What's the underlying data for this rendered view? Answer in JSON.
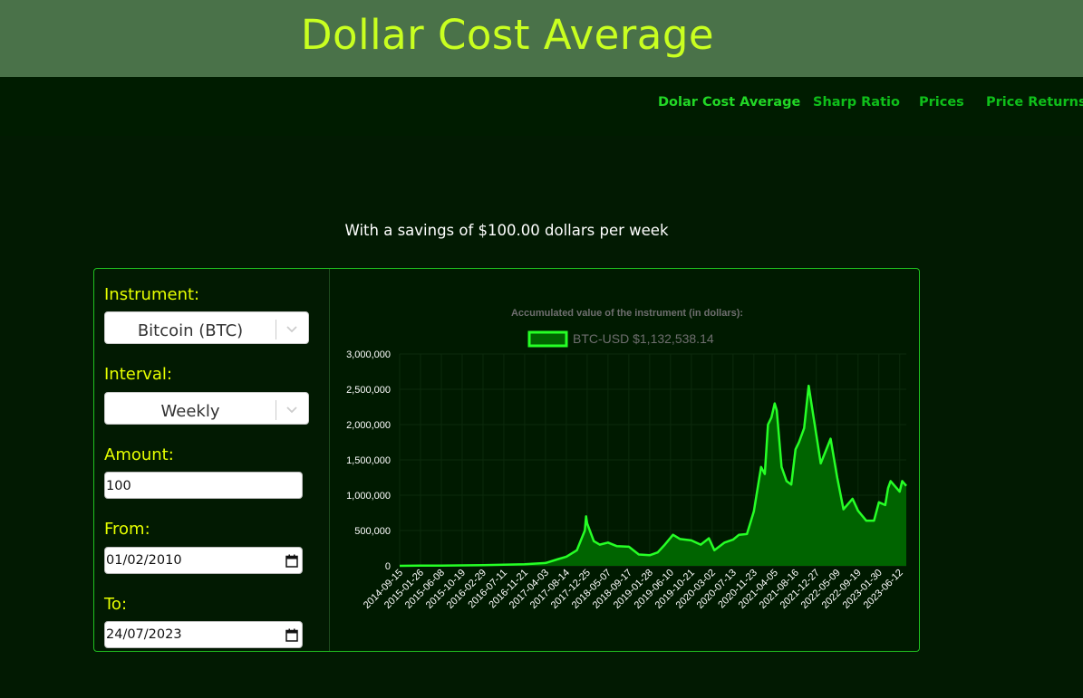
{
  "header": {
    "title": "Dollar Cost Average"
  },
  "nav": {
    "items": [
      {
        "label": "Dolar Cost Average"
      },
      {
        "label": "Sharp Ratio"
      },
      {
        "label": "Prices"
      },
      {
        "label": "Price Returns"
      }
    ]
  },
  "summary": {
    "text": "With a savings of $100.00 dollars per week"
  },
  "form": {
    "instrument_label": "Instrument:",
    "instrument_value": "Bitcoin (BTC)",
    "interval_label": "Interval:",
    "interval_value": "Weekly",
    "amount_label": "Amount:",
    "amount_value": "100",
    "from_label": "From:",
    "from_value": "01/02/2010",
    "to_label": "To:",
    "to_value": "24/07/2023"
  },
  "colors": {
    "banner_bg": "#4a7249",
    "title": "#c9ff20",
    "nav_bg": "#001c00",
    "nav_link": "#0fbf1a",
    "page_bg": "#021a02",
    "label": "#e6ff00",
    "line": "#26ff26",
    "fill": "#006400"
  },
  "icons": {
    "dropdown": "chevron-down-icon",
    "calendar": "calendar-icon"
  },
  "chart_data": {
    "type": "area",
    "title": "Accumulated value of the instrument (in dollars):",
    "legend": {
      "label": "BTC-USD $1,132,538.14",
      "placement": "top-center"
    },
    "y_ticks": [
      "0",
      "500,000",
      "1,000,000",
      "1,500,000",
      "2,000,000",
      "2,500,000",
      "3,000,000"
    ],
    "ylim": [
      0,
      3000000
    ],
    "x_ticks": [
      "2014-09-15",
      "2015-01-26",
      "2015-06-08",
      "2015-10-19",
      "2016-02-29",
      "2016-07-11",
      "2016-11-21",
      "2017-04-03",
      "2017-08-14",
      "2017-12-25",
      "2018-05-07",
      "2018-09-17",
      "2019-01-28",
      "2019-06-10",
      "2019-10-21",
      "2020-03-02",
      "2020-07-13",
      "2020-11-23",
      "2021-04-05",
      "2021-08-16",
      "2021-12-27",
      "2022-05-09",
      "2022-09-19",
      "2023-01-30",
      "2023-06-12"
    ],
    "xlim": [
      "2014-09-15",
      "2023-07-24"
    ],
    "series": [
      {
        "name": "BTC-USD",
        "points": [
          [
            "2014-09-15",
            0
          ],
          [
            "2015-01-26",
            2000
          ],
          [
            "2015-06-08",
            4000
          ],
          [
            "2015-10-19",
            6000
          ],
          [
            "2016-02-29",
            10000
          ],
          [
            "2016-07-11",
            15000
          ],
          [
            "2016-11-21",
            22000
          ],
          [
            "2017-04-03",
            40000
          ],
          [
            "2017-06-15",
            90000
          ],
          [
            "2017-08-14",
            130000
          ],
          [
            "2017-10-20",
            220000
          ],
          [
            "2017-12-10",
            500000
          ],
          [
            "2017-12-18",
            700000
          ],
          [
            "2017-12-25",
            600000
          ],
          [
            "2018-02-05",
            350000
          ],
          [
            "2018-03-15",
            300000
          ],
          [
            "2018-05-07",
            330000
          ],
          [
            "2018-07-01",
            280000
          ],
          [
            "2018-09-17",
            270000
          ],
          [
            "2018-11-20",
            160000
          ],
          [
            "2019-01-28",
            150000
          ],
          [
            "2019-03-20",
            190000
          ],
          [
            "2019-05-01",
            290000
          ],
          [
            "2019-06-26",
            440000
          ],
          [
            "2019-08-10",
            380000
          ],
          [
            "2019-10-21",
            360000
          ],
          [
            "2019-12-20",
            300000
          ],
          [
            "2020-02-10",
            390000
          ],
          [
            "2020-03-16",
            220000
          ],
          [
            "2020-05-20",
            330000
          ],
          [
            "2020-07-13",
            370000
          ],
          [
            "2020-08-20",
            440000
          ],
          [
            "2020-10-10",
            450000
          ],
          [
            "2020-11-23",
            770000
          ],
          [
            "2021-01-08",
            1400000
          ],
          [
            "2021-02-01",
            1300000
          ],
          [
            "2021-02-21",
            2000000
          ],
          [
            "2021-03-15",
            2100000
          ],
          [
            "2021-04-05",
            2300000
          ],
          [
            "2021-04-18",
            2200000
          ],
          [
            "2021-05-19",
            1400000
          ],
          [
            "2021-06-20",
            1200000
          ],
          [
            "2021-07-20",
            1150000
          ],
          [
            "2021-08-16",
            1650000
          ],
          [
            "2021-09-07",
            1750000
          ],
          [
            "2021-10-10",
            1950000
          ],
          [
            "2021-11-08",
            2550000
          ],
          [
            "2021-11-25",
            2300000
          ],
          [
            "2021-12-27",
            1850000
          ],
          [
            "2022-01-24",
            1450000
          ],
          [
            "2022-03-28",
            1800000
          ],
          [
            "2022-05-09",
            1250000
          ],
          [
            "2022-06-18",
            800000
          ],
          [
            "2022-08-15",
            950000
          ],
          [
            "2022-09-19",
            780000
          ],
          [
            "2022-11-10",
            640000
          ],
          [
            "2022-12-30",
            640000
          ],
          [
            "2023-01-30",
            900000
          ],
          [
            "2023-03-12",
            860000
          ],
          [
            "2023-03-30",
            1100000
          ],
          [
            "2023-04-15",
            1200000
          ],
          [
            "2023-06-12",
            1050000
          ],
          [
            "2023-06-28",
            1200000
          ],
          [
            "2023-07-24",
            1132538
          ]
        ]
      }
    ]
  }
}
